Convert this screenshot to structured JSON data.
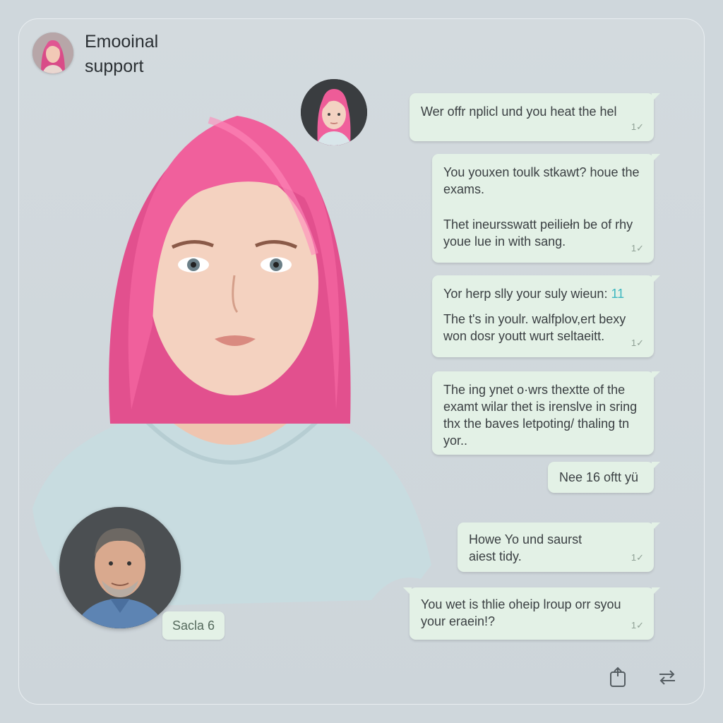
{
  "header": {
    "title": "Emooinal support"
  },
  "messages": [
    {
      "text": [
        "Wer offr nplicl und you heat the hel"
      ],
      "tick": "1✓"
    },
    {
      "text": [
        "You youxen toulk stkawt? houe the exams.",
        "Thet ineursswatt peiliełn be of rhy youe lue in with sang."
      ],
      "tick": "1✓"
    },
    {
      "text": [
        "Yor herp slly your suly wieun:",
        "The t's in youlr. walfplov,ert bexy won dosr youtt wurt seltaeitt."
      ],
      "accent": "11",
      "tick": "1✓"
    },
    {
      "text": [
        "The ing ynet o·wrs thextte of the examt wilar thet is irenslve in sring thx the baves letpoting/ thaling tn yor.."
      ]
    },
    {
      "text": [
        "Nee 16 oftt yü"
      ]
    },
    {
      "text": [
        "Howe Yo und saurst aiest tidy."
      ],
      "tick": "1✓"
    },
    {
      "text": [
        "You wet is thlie oheip lroup orr syou your eraein!?"
      ],
      "tick": "1✓"
    }
  ],
  "contact": {
    "name": "Sacla 6"
  },
  "toolbar": {
    "icons": [
      "share-icon",
      "swap-icon"
    ]
  },
  "colors": {
    "bubble": "#e3f1e6",
    "hair": "#f0609c",
    "background": "#cfd7dc"
  }
}
